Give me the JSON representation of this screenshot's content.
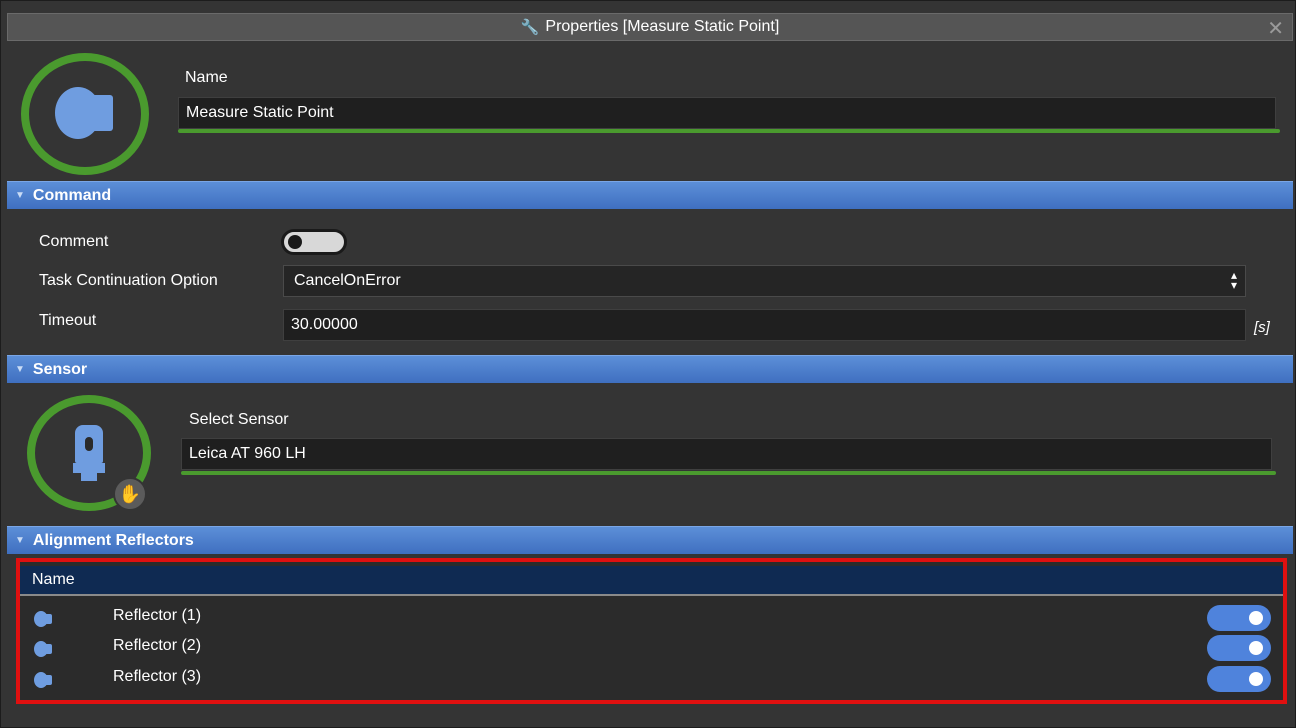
{
  "window": {
    "title": "Properties [Measure Static Point]",
    "close_icon": "close-icon",
    "title_icon": "wrench-icon"
  },
  "header": {
    "name_label": "Name",
    "name_value": "Measure Static Point",
    "icon": "measure-point-icon"
  },
  "command": {
    "section_label": "Command",
    "comment_label": "Comment",
    "comment_enabled": false,
    "task_label": "Task Continuation Option",
    "task_value": "CancelOnError",
    "timeout_label": "Timeout",
    "timeout_value": "30.00000",
    "timeout_unit": "[s]"
  },
  "sensor": {
    "section_label": "Sensor",
    "select_label": "Select Sensor",
    "select_value": "Leica AT 960 LH",
    "icon": "laser-tracker-icon",
    "badge_icon": "touch-hand-icon"
  },
  "reflectors": {
    "section_label": "Alignment Reflectors",
    "column_header": "Name",
    "items": [
      {
        "label": "Reflector (1)",
        "enabled": true
      },
      {
        "label": "Reflector (2)",
        "enabled": true
      },
      {
        "label": "Reflector (3)",
        "enabled": true
      }
    ]
  },
  "colors": {
    "accent_green": "#4a9a2e",
    "section_blue": "#4f80cc",
    "icon_blue": "#6f9de0",
    "highlight_red": "#e01010"
  }
}
